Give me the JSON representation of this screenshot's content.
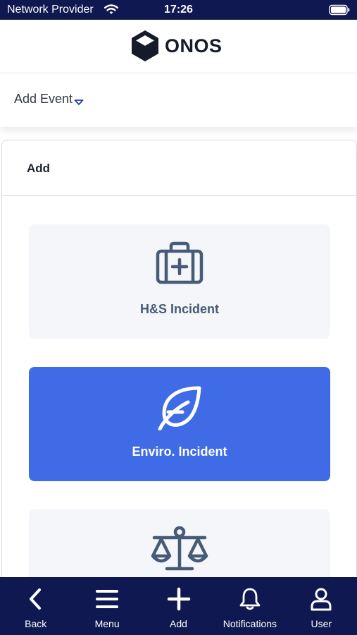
{
  "status_bar": {
    "carrier": "Network Provider",
    "time": "17:26",
    "icons": [
      "wifi-icon",
      "battery-icon"
    ]
  },
  "header": {
    "logo_text": "ONOS"
  },
  "event_selector": {
    "label": "Add Event",
    "icon": "chevron-down-icon"
  },
  "add_card": {
    "title": "Add",
    "tiles": [
      {
        "label": "H&S Incident",
        "icon": "first-aid-kit-icon",
        "selected": false
      },
      {
        "label": "Enviro. Incident",
        "icon": "leaf-icon",
        "selected": true
      },
      {
        "label": "",
        "icon": "scales-icon",
        "selected": false
      }
    ]
  },
  "bottom_nav": {
    "items": [
      {
        "label": "Back",
        "icon": "back-arrow-icon"
      },
      {
        "label": "Menu",
        "icon": "menu-icon"
      },
      {
        "label": "Add",
        "icon": "plus-icon"
      },
      {
        "label": "Notifications",
        "icon": "bell-icon"
      },
      {
        "label": "User",
        "icon": "user-icon"
      }
    ]
  },
  "colors": {
    "navy": "#0f1850",
    "accent": "#3f6be6",
    "tile_bg": "#f4f6fa",
    "tile_text": "#475a76"
  }
}
